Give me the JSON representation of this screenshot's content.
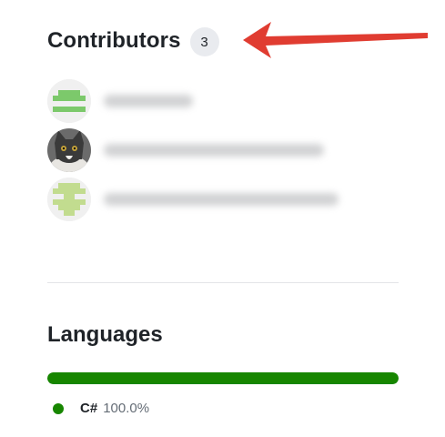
{
  "contributors": {
    "title": "Contributors",
    "count": "3",
    "items": [
      {
        "avatar": "identicon-green-avatar",
        "name_blurred": true
      },
      {
        "avatar": "cat-photo-avatar",
        "name_blurred": true
      },
      {
        "avatar": "identicon-lime-avatar",
        "name_blurred": true
      }
    ]
  },
  "annotation": {
    "arrow_color": "#e03c31",
    "icon": "arrow-left-icon"
  },
  "languages": {
    "title": "Languages",
    "items": [
      {
        "name": "C#",
        "percent": "100.0%",
        "fraction": 1.0,
        "color": "#178600"
      }
    ]
  }
}
